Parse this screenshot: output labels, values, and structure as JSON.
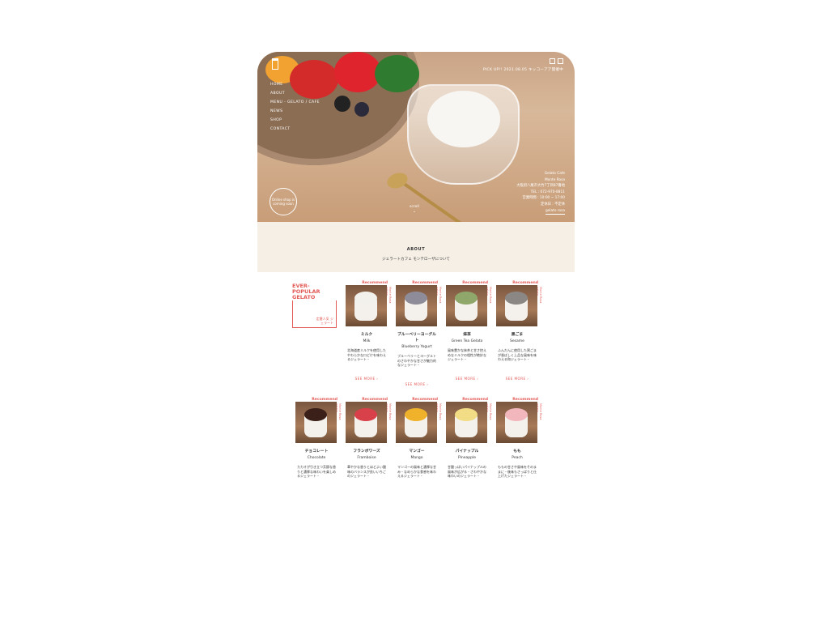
{
  "hero": {
    "pickup": "PICK UP!! 2021.08.05 キッコーアア開催中",
    "nav": [
      "HOME",
      "ABOUT",
      "MENU - GELATO / CAFE",
      "NEWS",
      "SHOP",
      "CONTACT"
    ],
    "badge": "Online shop is coming soon",
    "scroll": "scroll",
    "shop_info": [
      "Gelato Cafe",
      "Monte Rosa",
      "大阪府八尾市大竹7丁目87番地",
      "TEL : 072-970-8811",
      "営業時間 : 10:00 ~ 17:00",
      "定休日 : 不定休",
      "gelato rosa"
    ]
  },
  "about": {
    "title": "ABOUT",
    "subtitle": "ジェラートカフェ モンテローザについて"
  },
  "feature": {
    "title": "EVER-\nPOPULAR\nGELATO",
    "subtitle": "定番人気 ジェラート"
  },
  "labels": {
    "recommend": "Recommend",
    "see_more": "SEE MORE ›",
    "vertical": "Monte Rosa gelato"
  },
  "products_row1": [
    {
      "jp": "ミルク",
      "en": "Milk",
      "desc": "北海道産ミルクを使用したやわらかな口どけを味わえるジェラート・",
      "color": "#f3f1ec"
    },
    {
      "jp": "ブルーベリーヨーグルト",
      "en": "Blueberry Yogurt",
      "desc": "ブルーベリーとヨーグルトのさわやかな甘さが魅力的なジェラート・",
      "color": "#8f8c99"
    },
    {
      "jp": "抹茶",
      "en": "Green Tea Gelato",
      "desc": "風味豊かな抹茶と甘さ控えめなミルクの相性が絶妙なジェラート・",
      "color": "#8fa76b"
    },
    {
      "jp": "黒ごま",
      "en": "Sesame",
      "desc": "ふんだんに使用した黒ごまが香ばしく上品な風味を味わえる和ジェラート・",
      "color": "#8b8784"
    }
  ],
  "products_row2": [
    {
      "jp": "チョコレート",
      "en": "Chocolate",
      "desc": "カカオが引き立つ芳醇な香りと濃厚な味わいを楽しめるジェラート・",
      "color": "#3a2018"
    },
    {
      "jp": "フランボワーズ",
      "en": "Framboise",
      "desc": "華やかな香りとほどよい酸味のバランスが良いいちごのジェラート・",
      "color": "#d8404a"
    },
    {
      "jp": "マンゴー",
      "en": "Mango",
      "desc": "マンゴーの風味と濃厚な甘み・なめらかな食感を味わえるジェラート・",
      "color": "#f0b22a"
    },
    {
      "jp": "パイナップル",
      "en": "Pineapple",
      "desc": "甘酸っぱいパイナップルの風味が広がる・さわやかな味わいのジェラート・",
      "color": "#f2dc86"
    },
    {
      "jp": "もも",
      "en": "Peach",
      "desc": "ももの甘さや風味をそのままに・後味もさっぱりと仕上げたジェラート・",
      "color": "#f2b7bd"
    }
  ]
}
